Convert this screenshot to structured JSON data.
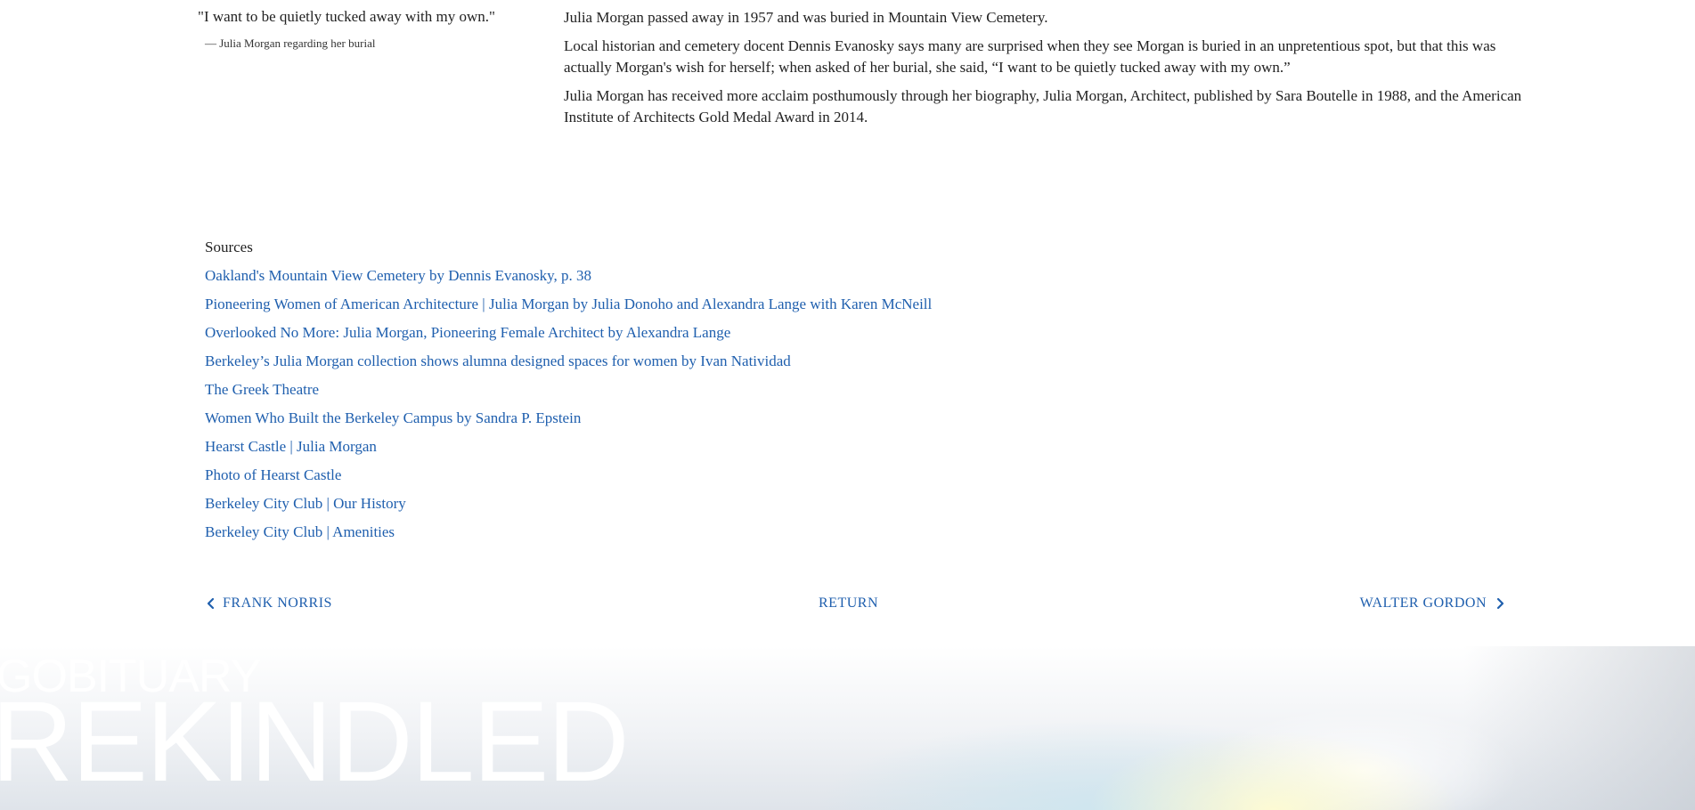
{
  "quote": {
    "text": "\"I want to be quietly tucked away with my own.\"",
    "attribution": "— Julia Morgan regarding her burial"
  },
  "body": {
    "paragraphs": [
      "Julia Morgan passed away in 1957 and was buried in Mountain View Cemetery.",
      "Local historian and cemetery docent Dennis Evanosky says many are surprised when they see Morgan is buried in an unpretentious spot, but that this was actually Morgan's wish for herself; when asked of her burial, she said, “I want to be quietly tucked away with my own.”",
      "Julia Morgan has received more acclaim posthumously through her biography, Julia Morgan, Architect, published by Sara Boutelle in 1988, and the American Institute of Architects Gold Medal Award in 2014."
    ]
  },
  "sources": {
    "title": "Sources",
    "links": [
      "Oakland's Mountain View Cemetery by Dennis Evanosky, p. 38",
      "Pioneering Women of American Architecture | Julia Morgan by Julia Donoho and Alexandra Lange with Karen McNeill",
      "Overlooked No More: Julia Morgan, Pioneering Female Architect by Alexandra Lange",
      "Berkeley’s Julia Morgan collection shows alumna designed spaces for women by Ivan Natividad",
      "The Greek Theatre",
      "Women Who Built the Berkeley Campus by Sandra P. Epstein",
      "Hearst Castle | Julia Morgan",
      "Photo of Hearst Castle",
      "Berkeley City Club | Our History",
      "Berkeley City Club | Amenities"
    ]
  },
  "nav": {
    "prev_label": "FRANK NORRIS",
    "return_label": "RETURN",
    "next_label": "WALTER GORDON",
    "prev_icon": "chevron-left-icon",
    "next_icon": "chevron-right-icon"
  },
  "footer": {
    "brand_small": "GOBITUARY",
    "brand_big": "REKINDLED"
  },
  "colors": {
    "link": "#1f5fae",
    "text": "#222222",
    "background": "#ffffff"
  }
}
